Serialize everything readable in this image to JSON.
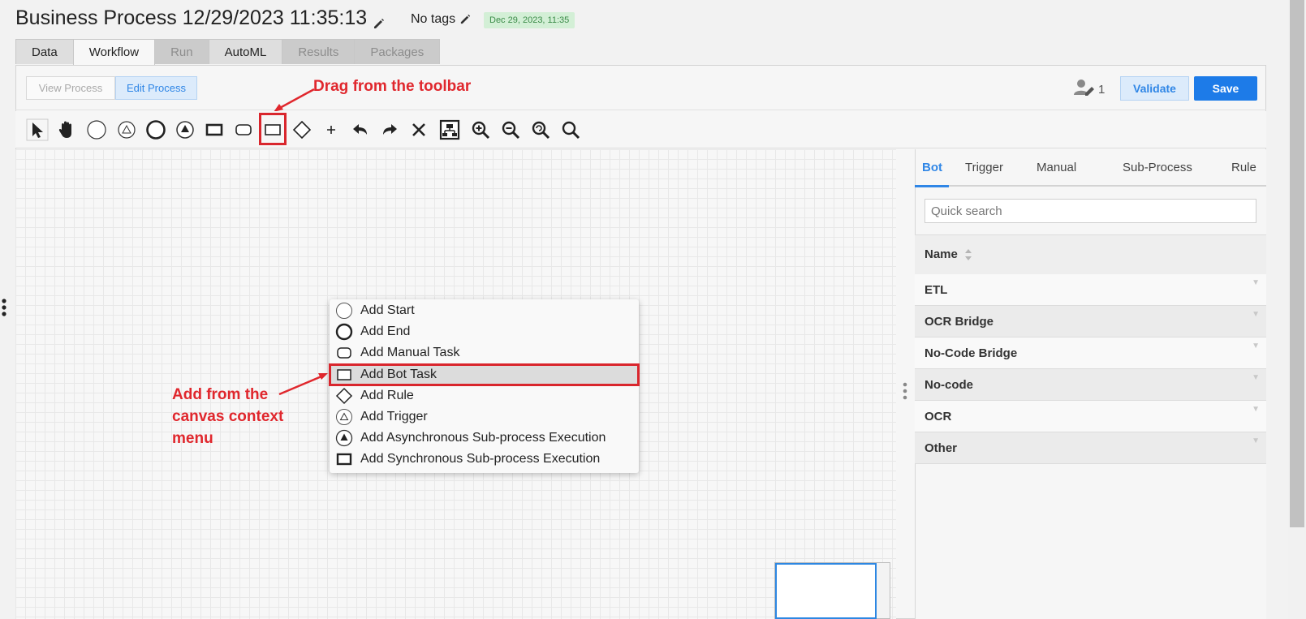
{
  "header": {
    "title": "Business Process 12/29/2023 11:35:13",
    "tags": "No tags",
    "date_badge": "Dec 29, 2023, 11:35"
  },
  "tabs": [
    {
      "label": "Data",
      "state": "normal"
    },
    {
      "label": "Workflow",
      "state": "active"
    },
    {
      "label": "Run",
      "state": "disabled"
    },
    {
      "label": "AutoML",
      "state": "normal"
    },
    {
      "label": "Results",
      "state": "disabled"
    },
    {
      "label": "Packages",
      "state": "disabled"
    }
  ],
  "mode_buttons": {
    "view": "View Process",
    "edit": "Edit Process"
  },
  "top_actions": {
    "users_count": "1",
    "validate": "Validate",
    "save": "Save"
  },
  "annotations": {
    "toolbar_callout": "Drag from the toolbar",
    "context_callout_lines": [
      "Add from the",
      "canvas context",
      "menu"
    ]
  },
  "toolbar_tools": [
    "pointer-icon",
    "hand-pan-icon",
    "start-event-icon",
    "trigger-event-icon",
    "end-event-icon",
    "async-subprocess-icon",
    "sync-subprocess-icon",
    "manual-task-icon",
    "bot-task-icon",
    "rule-gateway-icon",
    "add-icon",
    "undo-icon",
    "redo-icon",
    "delete-icon",
    "auto-layout-icon",
    "zoom-in-icon",
    "zoom-out-icon",
    "zoom-reset-icon",
    "zoom-fit-icon"
  ],
  "context_menu": {
    "items": [
      {
        "label": "Add Start",
        "icon": "start-event-icon"
      },
      {
        "label": "Add End",
        "icon": "end-event-icon"
      },
      {
        "label": "Add Manual Task",
        "icon": "manual-task-icon"
      },
      {
        "label": "Add Bot Task",
        "icon": "bot-task-icon",
        "selected": true
      },
      {
        "label": "Add Rule",
        "icon": "rule-gateway-icon"
      },
      {
        "label": "Add Trigger",
        "icon": "trigger-event-icon"
      },
      {
        "label": "Add Asynchronous Sub-process Execution",
        "icon": "async-subprocess-icon"
      },
      {
        "label": "Add Synchronous Sub-process Execution",
        "icon": "sync-subprocess-icon"
      }
    ]
  },
  "right_panel": {
    "tabs": [
      "Bot",
      "Trigger",
      "Manual",
      "Sub-Process",
      "Rule"
    ],
    "active_tab": "Bot",
    "search_placeholder": "Quick search",
    "column_header": "Name",
    "rows": [
      "ETL",
      "OCR Bridge",
      "No-Code Bridge",
      "No-code",
      "OCR",
      "Other"
    ]
  },
  "colors": {
    "accent": "#2f86e6",
    "save_button": "#1d7be8",
    "annotation_red": "#d9262d",
    "badge_green": "#d3efd6"
  }
}
